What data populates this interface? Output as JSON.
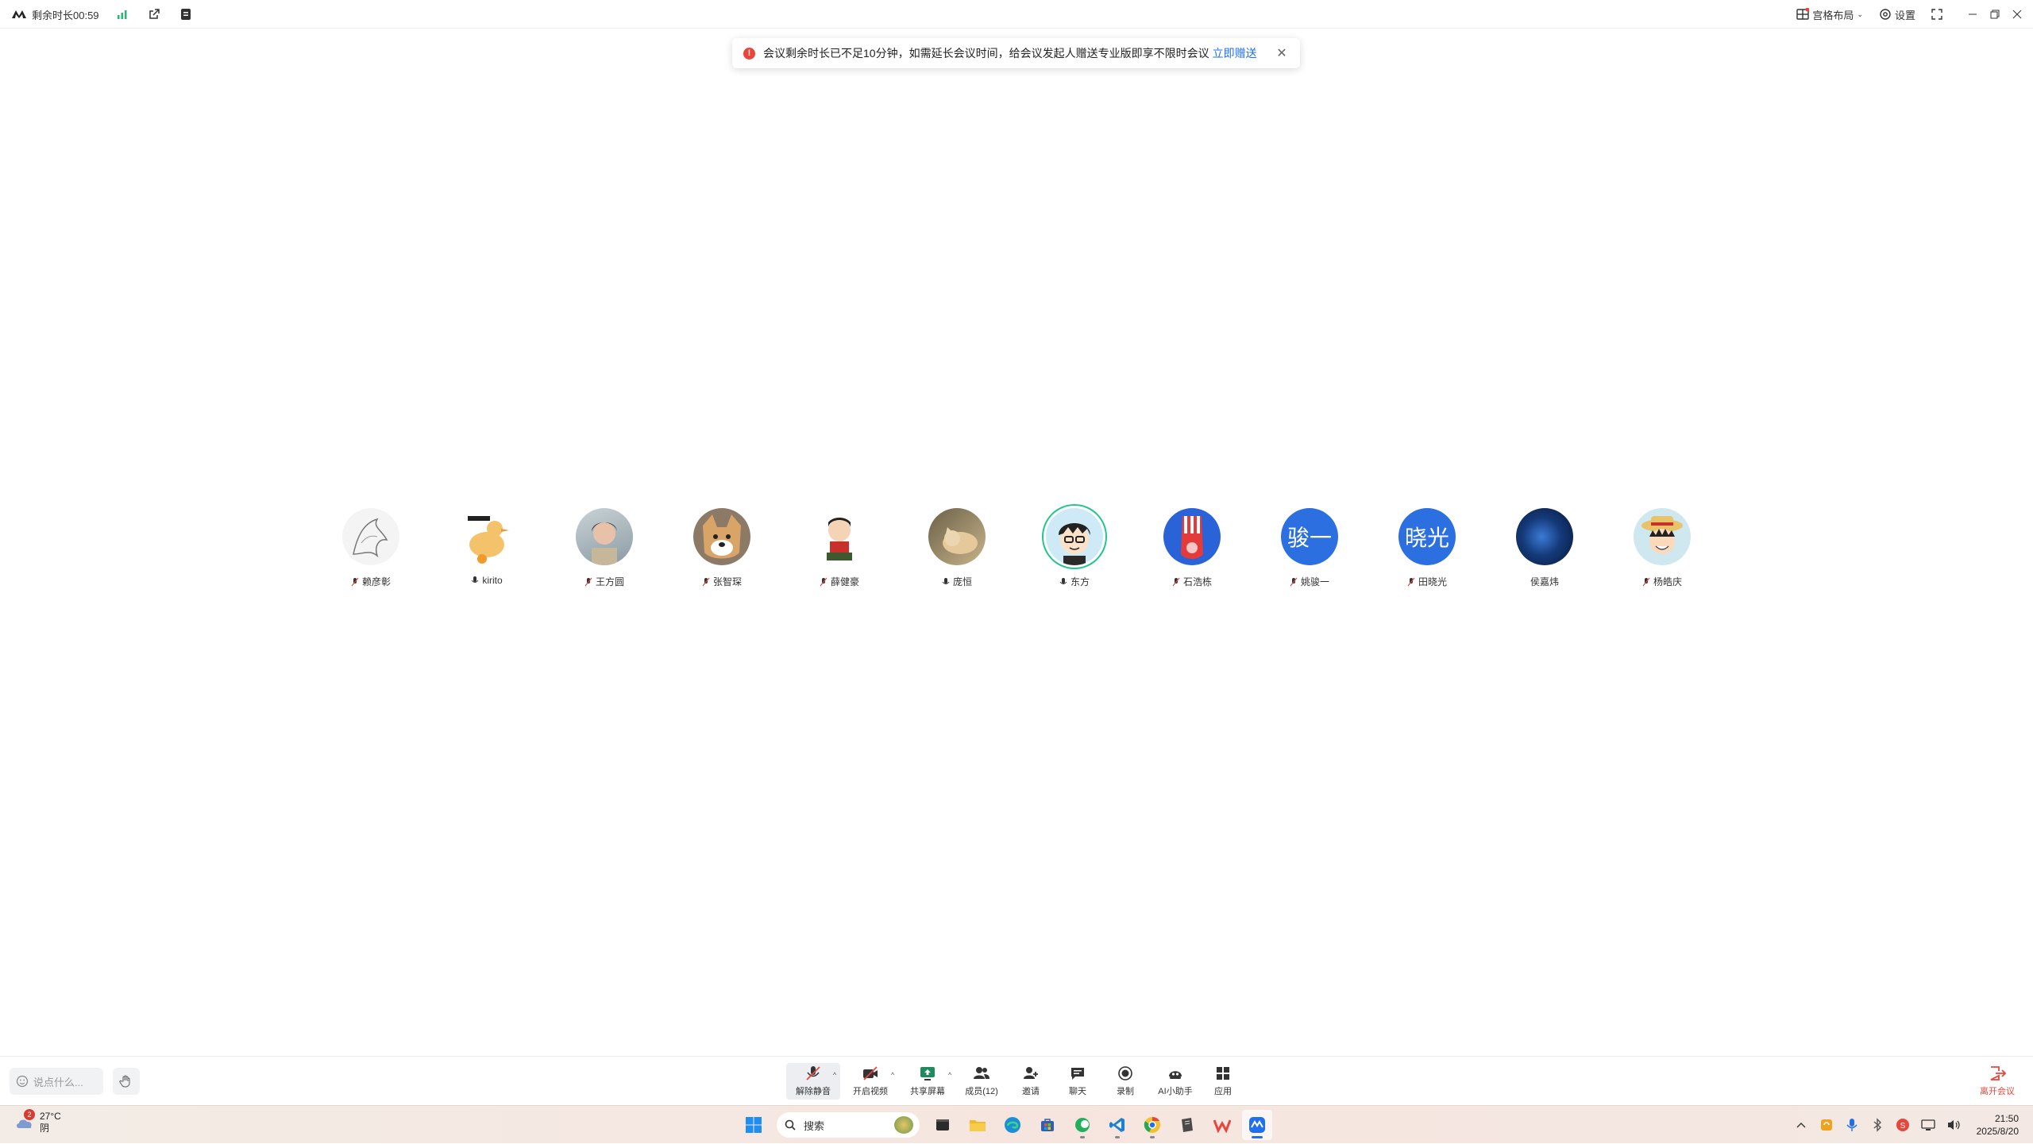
{
  "titlebar": {
    "remaining_time": "剩余时长00:59",
    "layout_label": "宫格布局",
    "settings_label": "设置"
  },
  "toast": {
    "message": "会议剩余时长已不足10分钟，如需延长会议时间，给会议发起人赠送专业版即享不限时会议",
    "link": "立即赠送"
  },
  "participants": [
    {
      "name": "赖彦彰",
      "mic": "muted",
      "avatar": "sketch"
    },
    {
      "name": "kirito",
      "mic": "on",
      "avatar": "duck"
    },
    {
      "name": "王方圆",
      "mic": "muted",
      "avatar": "photo-woman"
    },
    {
      "name": "张智琛",
      "mic": "muted",
      "avatar": "shiba"
    },
    {
      "name": "薛健豪",
      "mic": "muted",
      "avatar": "cartoon-boy"
    },
    {
      "name": "庞恒",
      "mic": "on",
      "avatar": "cat"
    },
    {
      "name": "东方",
      "mic": "on",
      "avatar": "glasses-boy",
      "speaking": true
    },
    {
      "name": "石浩栋",
      "mic": "muted",
      "avatar": "red-hand"
    },
    {
      "name": "姚骏一",
      "mic": "muted",
      "avatar_text": "骏一"
    },
    {
      "name": "田晓光",
      "mic": "muted",
      "avatar_text": "晓光"
    },
    {
      "name": "侯嘉炜",
      "mic": "none",
      "avatar": "aurora"
    },
    {
      "name": "杨皓庆",
      "mic": "muted",
      "avatar": "straw-hat"
    }
  ],
  "toolbar": {
    "chat_placeholder": "说点什么...",
    "unmute": "解除静音",
    "video": "开启视频",
    "share": "共享屏幕",
    "members": "成员(12)",
    "invite": "邀请",
    "chat": "聊天",
    "record": "录制",
    "ai": "AI小助手",
    "apps": "应用",
    "leave": "离开会议"
  },
  "taskbar": {
    "weather_badge": "2",
    "temperature": "27°C",
    "weather": "阴",
    "search": "搜索",
    "time": "21:50",
    "date": "2025/8/20"
  },
  "colors": {
    "accent": "#1f6ff0",
    "danger": "#e8463c",
    "speaking": "#22c58e"
  }
}
